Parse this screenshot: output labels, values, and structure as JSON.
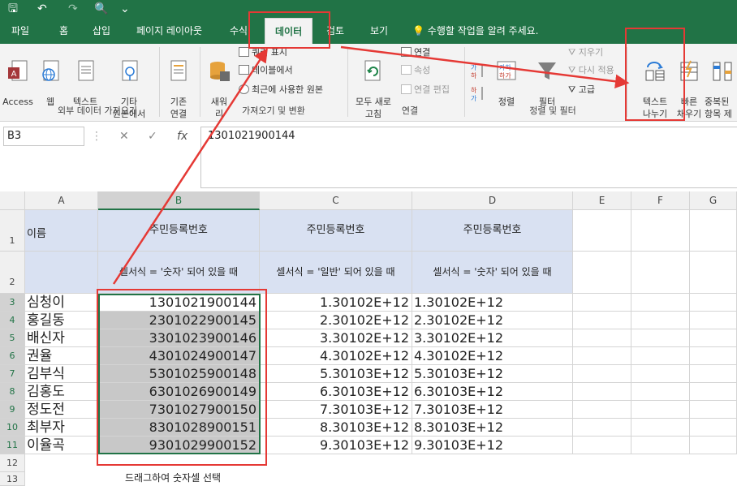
{
  "quick_access": {
    "save": "🖫",
    "undo": "↶",
    "redo": "↷",
    "preview": "🔍",
    "more": "⌄"
  },
  "tabs": [
    "파일",
    "홈",
    "삽입",
    "페이지 레이아웃",
    "수식",
    "데이터",
    "검토",
    "보기"
  ],
  "tell_me": "수행할 작업을 알려 주세요.",
  "ribbon": {
    "get_external": {
      "label": "외부 데이터 가져오기",
      "access": "Access",
      "web": "웹",
      "text": "텍스트",
      "other": "기타\n원본에서"
    },
    "get_transform": {
      "label": "가져오기 및 변환",
      "existing": "기존\n연결",
      "new_query": "새워\n리",
      "show_query": "쿼리 표시",
      "from_table": "테이블에서",
      "recent": "최근에 사용한 원본"
    },
    "connections": {
      "label": "연결",
      "refresh_all": "모두 새로\n고침",
      "connections": "연결",
      "properties": "속성",
      "edit_links": "연결 편집"
    },
    "sort_filter": {
      "label": "정렬 및 필터",
      "sort": "정렬",
      "filter": "필터",
      "clear": "지우기",
      "reapply": "다시 적용",
      "advanced": "고급"
    },
    "data_tools": {
      "text_to_columns": "텍스트\n나누기",
      "flash_fill": "빠른\n채우기",
      "remove_dupes": "중복된\n항목 제"
    }
  },
  "formula_bar": {
    "name_box": "B3",
    "cancel": "✕",
    "enter": "✓",
    "fx": "fx",
    "formula": "1301021900144"
  },
  "sheet": {
    "col_headers": [
      "A",
      "B",
      "C",
      "D",
      "E",
      "F",
      "G"
    ],
    "row_headers": [
      "1",
      "2",
      "3",
      "4",
      "5",
      "6",
      "7",
      "8",
      "9",
      "10",
      "11",
      "12",
      "13"
    ],
    "a1": "이름",
    "row1_header": "주민등록번호",
    "b2": "셀서식 = '숫자' 되어 있을 때",
    "c2": "셀서식 = '일반' 되어 있을 때",
    "d2": "셀서식 = '숫자' 되어 있을 때",
    "names": [
      "심청이",
      "홍길동",
      "배신자",
      "권율",
      "김부식",
      "김홍도",
      "정도전",
      "최부자",
      "이율곡"
    ],
    "b_values": [
      "1301021900144",
      "2301022900145",
      "3301023900146",
      "4301024900147",
      "5301025900148",
      "6301026900149",
      "7301027900150",
      "8301028900151",
      "9301029900152"
    ],
    "cd_values": [
      "1.30102E+12",
      "2.30102E+12",
      "3.30102E+12",
      "4.30102E+12",
      "5.30103E+12",
      "6.30103E+12",
      "7.30103E+12",
      "8.30103E+12",
      "9.30103E+12"
    ]
  },
  "caption": "드래그하여 숫자셀 선택",
  "colors": {
    "excel_green": "#217346",
    "header_fill": "#d9e1f2",
    "annotation_red": "#e53935",
    "selection_fill": "#c8c8c8"
  }
}
